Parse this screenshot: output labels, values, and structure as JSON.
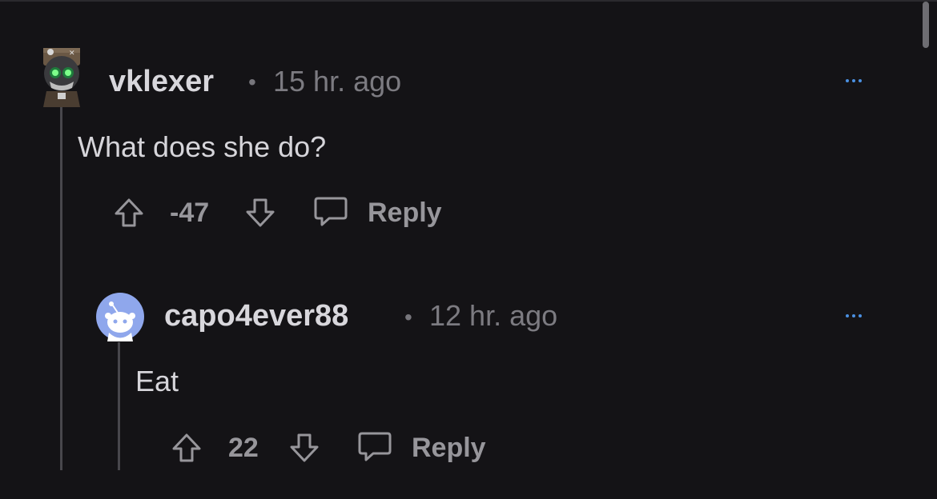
{
  "comments": [
    {
      "username": "vklexer",
      "separator": "•",
      "time": "15 hr. ago",
      "text": "What does she do?",
      "score": "-47",
      "reply_label": "Reply",
      "avatar": "robot-avatar-icon"
    },
    {
      "username": "capo4ever88",
      "separator": "•",
      "time": "12 hr. ago",
      "text": "Eat",
      "score": "22",
      "reply_label": "Reply",
      "avatar": "snoo-avatar-icon"
    }
  ],
  "colors": {
    "background": "#141316",
    "username": "#d8d7dc",
    "meta": "#7c7b81",
    "more_dots": "#4a90e2",
    "thread_line": "#48474c"
  }
}
